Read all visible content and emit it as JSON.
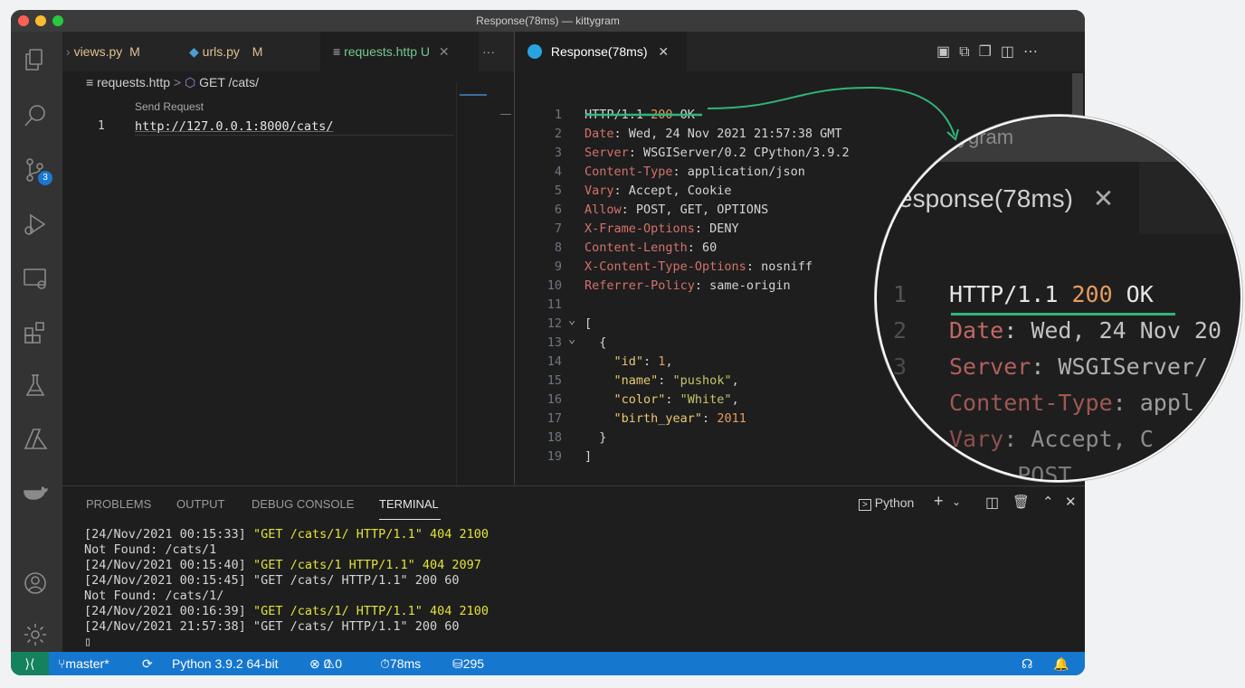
{
  "window": {
    "title": "Response(78ms) — kittygram"
  },
  "activity_bar": {
    "source_control_badge": "3"
  },
  "editor_left": {
    "tabs": [
      {
        "label": "views.py",
        "status": "M"
      },
      {
        "label": "urls.py",
        "status": "M"
      },
      {
        "label": "requests.http",
        "status": "U"
      }
    ],
    "more": "···",
    "breadcrumb": {
      "file": "requests.http",
      "sep": ">",
      "symbol": "GET /cats/"
    },
    "codelens": "Send Request",
    "line_number": "1",
    "line_text": "http://127.0.0.1:8000/cats/"
  },
  "editor_right": {
    "tab_label": "Response(78ms)",
    "lines": [
      {
        "n": "1",
        "key": "HTTP/1.1 ",
        "num": "200",
        "val": " OK"
      },
      {
        "n": "2",
        "key": "Date",
        "val": ": Wed, 24 Nov 2021 21:57:38 GMT"
      },
      {
        "n": "3",
        "key": "Server",
        "val": ": WSGIServer/0.2 CPython/3.9.2"
      },
      {
        "n": "4",
        "key": "Content-Type",
        "val": ": application/json"
      },
      {
        "n": "5",
        "key": "Vary",
        "val": ": Accept, Cookie"
      },
      {
        "n": "6",
        "key": "Allow",
        "val": ": POST, GET, OPTIONS"
      },
      {
        "n": "7",
        "key": "X-Frame-Options",
        "val": ": DENY"
      },
      {
        "n": "8",
        "key": "Content-Length",
        "val": ": 60"
      },
      {
        "n": "9",
        "key": "X-Content-Type-Options",
        "val": ": nosniff"
      },
      {
        "n": "10",
        "key": "Referrer-Policy",
        "val": ": same-origin"
      },
      {
        "n": "11",
        "key": "",
        "val": ""
      },
      {
        "n": "12",
        "key": "",
        "val": "["
      },
      {
        "n": "13",
        "key": "",
        "val": "  {"
      },
      {
        "n": "14",
        "jk": "    \"id\"",
        "val": ": ",
        "num": "1",
        "tail": ","
      },
      {
        "n": "15",
        "jk": "    \"name\"",
        "val": ": ",
        "str": "\"pushok\"",
        "tail": ","
      },
      {
        "n": "16",
        "jk": "    \"color\"",
        "val": ": ",
        "str": "\"White\"",
        "tail": ","
      },
      {
        "n": "17",
        "jk": "    \"birth_year\"",
        "val": ": ",
        "num": "2011"
      },
      {
        "n": "18",
        "key": "",
        "val": "  }"
      },
      {
        "n": "19",
        "key": "",
        "val": "]"
      }
    ]
  },
  "magnifier": {
    "title_fragment": "ygram",
    "tab_fragment": "esponse(78ms)",
    "close": "✕",
    "lines": [
      {
        "n": "1",
        "text": "HTTP/1.1 ",
        "num": "200",
        "tail": " OK"
      },
      {
        "n": "2",
        "key": "Date",
        "tail": ": Wed, 24 Nov 20"
      },
      {
        "n": "3",
        "key": "Server",
        "tail": ": WSGIServer/"
      },
      {
        "n": "",
        "key": "Content-Type",
        "tail": ": appl"
      },
      {
        "n": "",
        "key": "Vary",
        "tail": ": Accept, C"
      },
      {
        "n": "",
        "key": "",
        "tail": "     POST"
      }
    ]
  },
  "panel": {
    "tabs": [
      "PROBLEMS",
      "OUTPUT",
      "DEBUG CONSOLE",
      "TERMINAL"
    ],
    "active_tab": "TERMINAL",
    "shell": "Python",
    "terminal_lines": [
      {
        "pre": "[24/Nov/2021 00:15:33] ",
        "hl": "\"GET /cats/1/ HTTP/1.1\" 404 2100"
      },
      {
        "pre": "Not Found: /cats/1",
        "hl": ""
      },
      {
        "pre": "[24/Nov/2021 00:15:40] ",
        "hl": "\"GET /cats/1 HTTP/1.1\" 404 2097"
      },
      {
        "pre": "[24/Nov/2021 00:15:45] \"GET /cats/ HTTP/1.1\" 200 60",
        "hl": ""
      },
      {
        "pre": "Not Found: /cats/1/",
        "hl": ""
      },
      {
        "pre": "[24/Nov/2021 00:16:39] ",
        "hl": "\"GET /cats/1/ HTTP/1.1\" 404 2100"
      },
      {
        "pre": "[24/Nov/2021 21:57:38] \"GET /cats/ HTTP/1.1\" 200 60",
        "hl": ""
      },
      {
        "pre": "▯",
        "hl": ""
      }
    ]
  },
  "status_bar": {
    "branch": "master*",
    "python": "Python 3.9.2 64-bit",
    "errors": "0",
    "warnings": "0",
    "time": "78ms",
    "size": "295 B"
  },
  "colors": {
    "accent": "#1677cf",
    "http_key": "#d4716c",
    "number": "#e69b5e",
    "underline": "#2fb67a"
  }
}
